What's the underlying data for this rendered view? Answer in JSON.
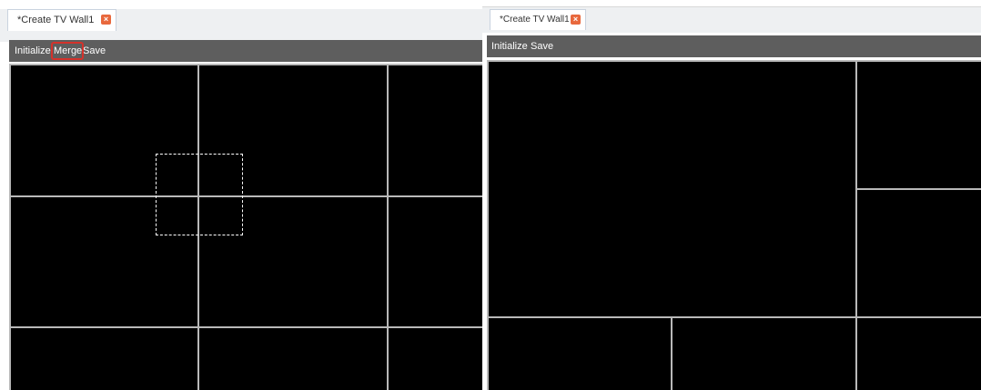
{
  "left_view": {
    "tab": {
      "title": "*Create TV Wall1",
      "close_icon": "close-icon"
    },
    "toolbar": {
      "initialize": "Initialize",
      "merge": "Merge",
      "save": "Save"
    },
    "highlight_color": "#d4322b"
  },
  "right_view": {
    "tab": {
      "title": "*Create TV Wall1",
      "close_icon": "close-icon"
    },
    "toolbar": {
      "initialize": "Initialize",
      "save": "Save"
    }
  },
  "colors": {
    "toolbar_bg": "#5e5e5e",
    "screen_bg": "#000000",
    "grid_line": "#b9b9b9",
    "close_icon": "#e8683d"
  }
}
